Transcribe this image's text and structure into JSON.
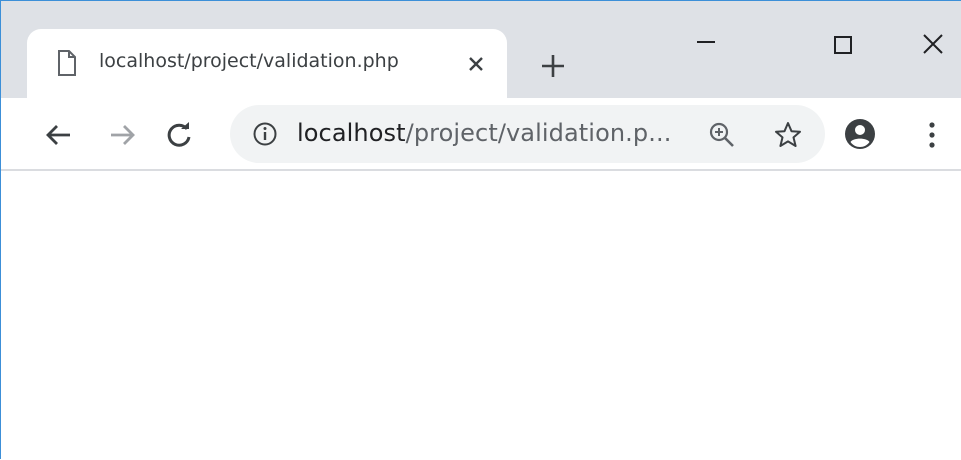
{
  "tab": {
    "title": "localhost/project/validation.php",
    "icon": "page-icon"
  },
  "omnibox": {
    "host": "localhost",
    "path": "/project/validation.p...",
    "left_icon": "info-icon",
    "right_icons": [
      "zoom-icon",
      "star-icon"
    ]
  },
  "toolbar": {
    "icons": [
      "back-arrow-icon",
      "forward-arrow-icon",
      "reload-icon",
      "profile-icon",
      "menu-icon"
    ]
  },
  "window_controls": [
    "minimize-icon",
    "maximize-icon",
    "close-icon"
  ],
  "colors": {
    "tabstrip": "#dee1e6",
    "omnibox_bg": "#f1f3f4",
    "text_dark": "#202124",
    "text_grey": "#5f6368",
    "window_border": "#3c8fd8"
  }
}
